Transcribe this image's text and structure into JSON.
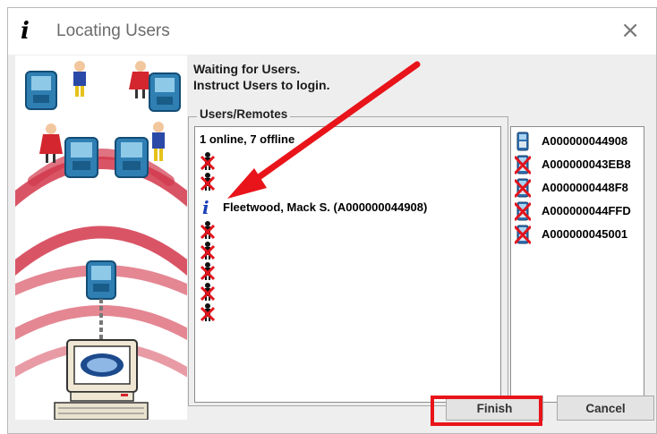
{
  "window": {
    "title": "Locating Users",
    "title_icon": "info-i-icon",
    "close_symbol": "×"
  },
  "instructions": {
    "line1": "Waiting for Users.",
    "line2": "Instruct Users to login."
  },
  "users_panel": {
    "group_label": "Users/Remotes",
    "status": "1 online, 7 offline",
    "users": [
      {
        "state": "offline",
        "name": ""
      },
      {
        "state": "offline",
        "name": ""
      },
      {
        "state": "online",
        "name": "Fleetwood, Mack S. (A000000044908)"
      },
      {
        "state": "offline",
        "name": ""
      },
      {
        "state": "offline",
        "name": ""
      },
      {
        "state": "offline",
        "name": ""
      },
      {
        "state": "offline",
        "name": ""
      },
      {
        "state": "offline",
        "name": ""
      }
    ]
  },
  "remotes_panel": {
    "remotes": [
      {
        "state": "online",
        "id": "A000000044908"
      },
      {
        "state": "offline",
        "id": "A000000043EB8"
      },
      {
        "state": "offline",
        "id": "A0000000448F8"
      },
      {
        "state": "offline",
        "id": "A000000044FFD"
      },
      {
        "state": "offline",
        "id": "A000000045001"
      }
    ]
  },
  "buttons": {
    "finish": "Finish",
    "cancel": "Cancel"
  },
  "annotations": {
    "arrow_color": "#e8141a",
    "highlight_color": "#e8141a"
  }
}
